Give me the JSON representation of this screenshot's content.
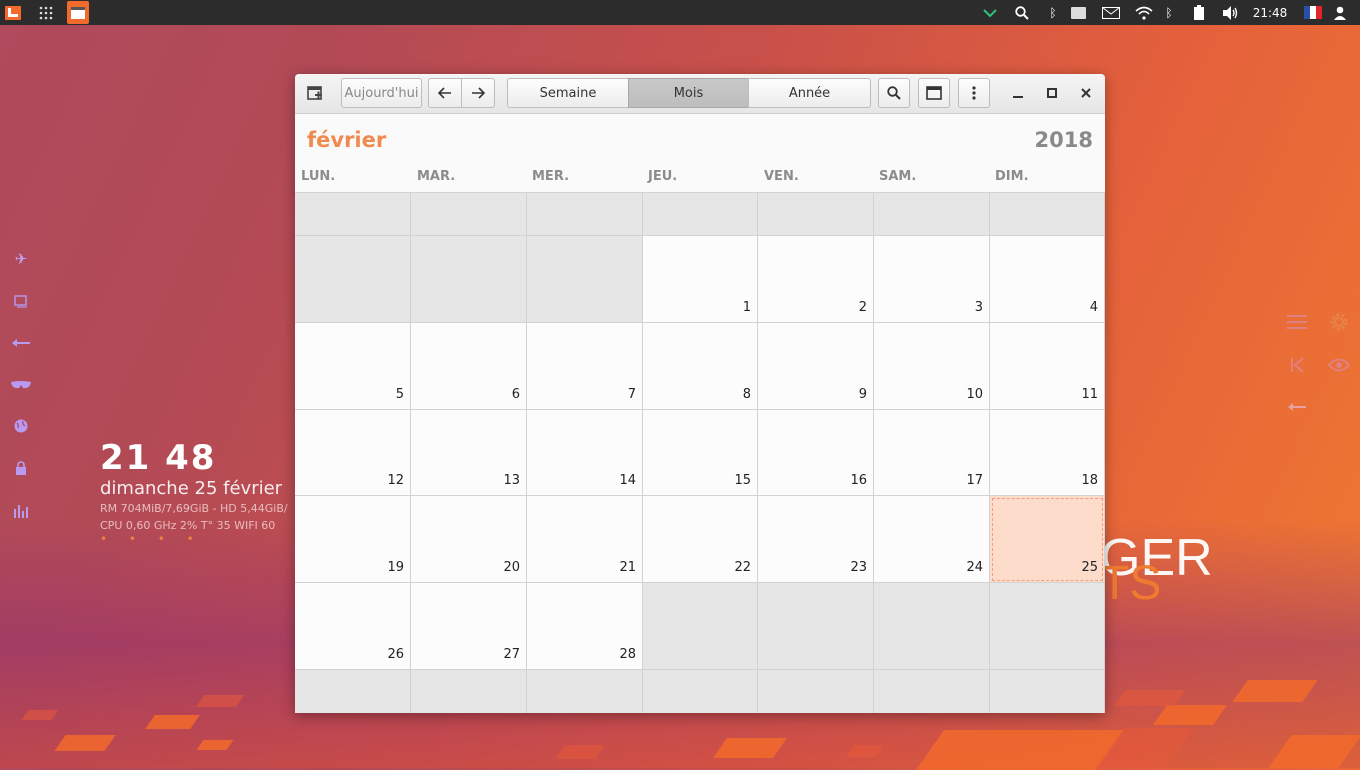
{
  "desktop": {
    "clock_time": "21 48",
    "clock_date": "dimanche 25 février",
    "sysinfo_line1": "RM 704MiB/7,69GiB - HD 5,44GiB/",
    "sysinfo_line2": "CPU 0,60 GHz 2% T° 35  WIFI 60",
    "dots": "• • • •",
    "big_text_1": "GER",
    "big_text_2": "TS"
  },
  "topbar": {
    "time": "21:48",
    "language": "FR"
  },
  "window": {
    "toolbar": {
      "today_label": "Aujourd'hui",
      "view_week": "Semaine",
      "view_month": "Mois",
      "view_year": "Année",
      "active_view": "Mois"
    },
    "month": "février",
    "year": "2018",
    "weekdays": [
      "LUN.",
      "MAR.",
      "MER.",
      "JEU.",
      "VEN.",
      "SAM.",
      "DIM."
    ],
    "weeks": [
      [
        "",
        "",
        "",
        "",
        "",
        "",
        ""
      ],
      [
        "",
        "",
        "",
        "1",
        "2",
        "3",
        "4"
      ],
      [
        "5",
        "6",
        "7",
        "8",
        "9",
        "10",
        "11"
      ],
      [
        "12",
        "13",
        "14",
        "15",
        "16",
        "17",
        "18"
      ],
      [
        "19",
        "20",
        "21",
        "22",
        "23",
        "24",
        "25"
      ],
      [
        "26",
        "27",
        "28",
        "",
        "",
        "",
        ""
      ],
      [
        "",
        "",
        "",
        "",
        "",
        "",
        ""
      ]
    ],
    "today": "25"
  }
}
